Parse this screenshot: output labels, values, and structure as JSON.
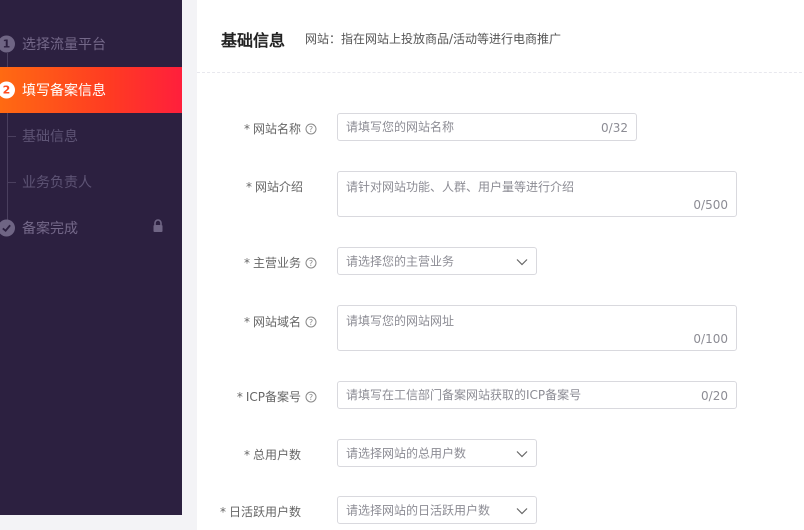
{
  "sidebar": {
    "steps": [
      {
        "num": "1",
        "label": "选择流量平台"
      },
      {
        "num": "2",
        "label": "填写备案信息"
      }
    ],
    "subitems": [
      "基础信息",
      "业务负责人"
    ],
    "final_step": {
      "label": "备案完成"
    }
  },
  "card": {
    "title": "基础信息",
    "desc": "网站：指在网站上投放商品/活动等进行电商推广"
  },
  "form": {
    "site_name": {
      "label": "网站名称",
      "placeholder": "请填写您的网站名称",
      "counter": "0/32"
    },
    "site_intro": {
      "label": "网站介绍",
      "placeholder": "请针对网站功能、人群、用户量等进行介绍",
      "counter": "0/500"
    },
    "main_business": {
      "label": "主营业务",
      "placeholder": "请选择您的主营业务"
    },
    "domain": {
      "label": "网站域名",
      "placeholder": "请填写您的网站网址",
      "counter": "0/100"
    },
    "icp": {
      "label": "ICP备案号",
      "placeholder": "请填写在工信部门备案网站获取的ICP备案号",
      "counter": "0/20"
    },
    "total_users": {
      "label": "总用户数",
      "placeholder": "请选择网站的总用户数"
    },
    "dau": {
      "label": "日活跃用户数",
      "placeholder": "请选择网站的日活跃用户数"
    }
  },
  "colors": {
    "accent_start": "#ff6a12",
    "accent_end": "#ff1f3c",
    "sidebar_bg": "#2c2040"
  }
}
